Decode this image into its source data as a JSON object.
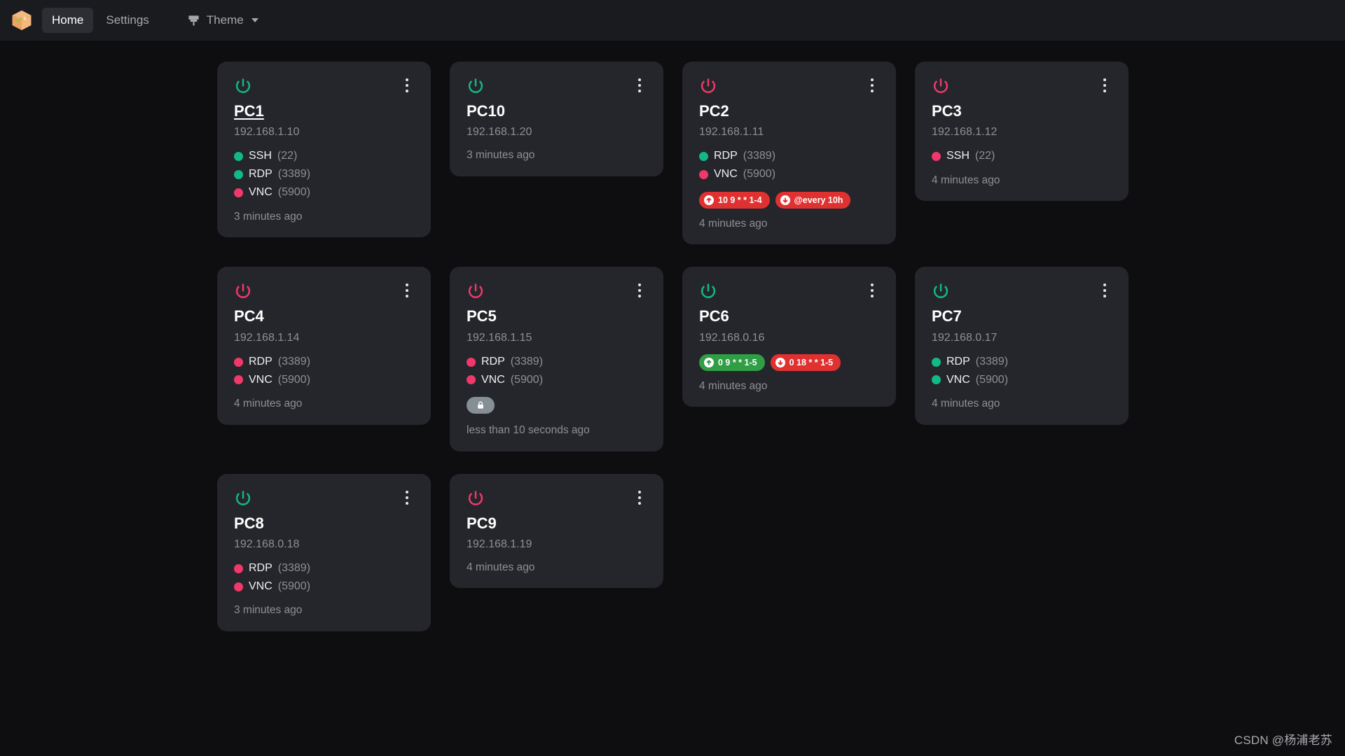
{
  "navbar": {
    "logo_icon": "package-box-icon",
    "items": [
      {
        "label": "Home",
        "active": true
      },
      {
        "label": "Settings",
        "active": false
      }
    ],
    "theme": {
      "label": "Theme",
      "icon": "paint-brush-icon",
      "caret_icon": "chevron-down-icon"
    }
  },
  "colors": {
    "page_bg": "#0e0e10",
    "nav_bg": "#1a1b1e",
    "card_bg": "#25262b",
    "active_pill": "#2c2e33",
    "green": "#12b886",
    "pink": "#f0386b",
    "badge_red": "#e03131",
    "badge_green": "#2f9e44",
    "muted_text": "#8e9096",
    "lock_pill": "#868e96"
  },
  "cards": [
    {
      "name": "PC1",
      "title_underlined": true,
      "power_state": "on",
      "ip": "192.168.1.10",
      "services": [
        {
          "label": "SSH",
          "port": "(22)",
          "status": "up"
        },
        {
          "label": "RDP",
          "port": "(3389)",
          "status": "up"
        },
        {
          "label": "VNC",
          "port": "(5900)",
          "status": "down"
        }
      ],
      "badges": [],
      "lock": false,
      "time": "3 minutes ago"
    },
    {
      "name": "PC10",
      "title_underlined": false,
      "power_state": "on",
      "ip": "192.168.1.20",
      "services": [],
      "badges": [],
      "lock": false,
      "time": "3 minutes ago"
    },
    {
      "name": "PC2",
      "title_underlined": false,
      "power_state": "off",
      "ip": "192.168.1.11",
      "services": [
        {
          "label": "RDP",
          "port": "(3389)",
          "status": "up"
        },
        {
          "label": "VNC",
          "port": "(5900)",
          "status": "down"
        }
      ],
      "badges": [
        {
          "text": "10 9 * * 1-4",
          "color": "red",
          "arrow": "up"
        },
        {
          "text": "@every 10h",
          "color": "red",
          "arrow": "down"
        }
      ],
      "lock": false,
      "time": "4 minutes ago"
    },
    {
      "name": "PC3",
      "title_underlined": false,
      "power_state": "off",
      "ip": "192.168.1.12",
      "services": [
        {
          "label": "SSH",
          "port": "(22)",
          "status": "down"
        }
      ],
      "badges": [],
      "lock": false,
      "time": "4 minutes ago"
    },
    {
      "name": "PC4",
      "title_underlined": false,
      "power_state": "off",
      "ip": "192.168.1.14",
      "services": [
        {
          "label": "RDP",
          "port": "(3389)",
          "status": "down"
        },
        {
          "label": "VNC",
          "port": "(5900)",
          "status": "down"
        }
      ],
      "badges": [],
      "lock": false,
      "time": "4 minutes ago"
    },
    {
      "name": "PC5",
      "title_underlined": false,
      "power_state": "off",
      "ip": "192.168.1.15",
      "services": [
        {
          "label": "RDP",
          "port": "(3389)",
          "status": "down"
        },
        {
          "label": "VNC",
          "port": "(5900)",
          "status": "down"
        }
      ],
      "badges": [],
      "lock": true,
      "time": "less than 10 seconds ago"
    },
    {
      "name": "PC6",
      "title_underlined": false,
      "power_state": "on",
      "ip": "192.168.0.16",
      "services": [],
      "badges": [
        {
          "text": "0 9 * * 1-5",
          "color": "green",
          "arrow": "up"
        },
        {
          "text": "0 18 * * 1-5",
          "color": "red",
          "arrow": "down"
        }
      ],
      "lock": false,
      "time": "4 minutes ago"
    },
    {
      "name": "PC7",
      "title_underlined": false,
      "power_state": "on",
      "ip": "192.168.0.17",
      "services": [
        {
          "label": "RDP",
          "port": "(3389)",
          "status": "up"
        },
        {
          "label": "VNC",
          "port": "(5900)",
          "status": "up"
        }
      ],
      "badges": [],
      "lock": false,
      "time": "4 minutes ago"
    },
    {
      "name": "PC8",
      "title_underlined": false,
      "power_state": "on",
      "ip": "192.168.0.18",
      "services": [
        {
          "label": "RDP",
          "port": "(3389)",
          "status": "down"
        },
        {
          "label": "VNC",
          "port": "(5900)",
          "status": "down"
        }
      ],
      "badges": [],
      "lock": false,
      "time": "3 minutes ago"
    },
    {
      "name": "PC9",
      "title_underlined": false,
      "power_state": "off",
      "ip": "192.168.1.19",
      "services": [],
      "badges": [],
      "lock": false,
      "time": "4 minutes ago"
    }
  ],
  "watermark": "CSDN @杨浦老苏"
}
